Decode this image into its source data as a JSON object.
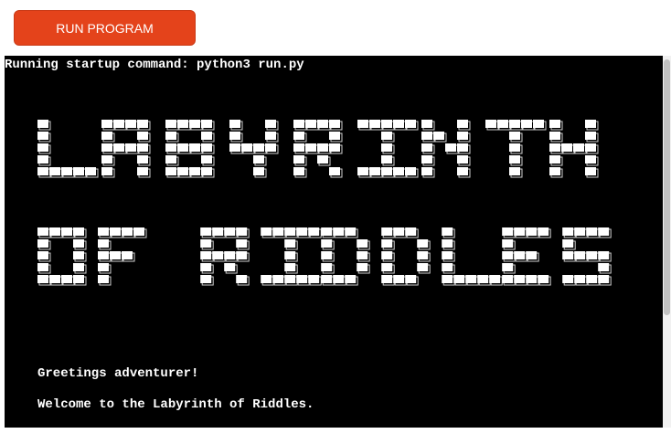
{
  "toolbar": {
    "run_label": "RUN PROGRAM"
  },
  "terminal": {
    "startup_line": "Running startup command: python3 run.py",
    "banner_lines": [
      "LABYRINTH",
      "OF RIDDLES"
    ],
    "messages": [
      "Greetings adventurer!",
      "Welcome to the Labyrinth of Riddles."
    ]
  },
  "colors": {
    "button": "#e4431b",
    "terminal_bg": "#000000",
    "terminal_fg": "#ffffff"
  }
}
